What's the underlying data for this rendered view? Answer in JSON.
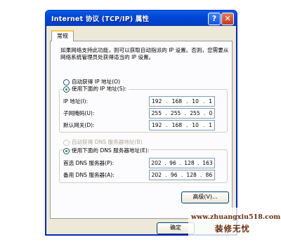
{
  "window": {
    "title": "Internet 协议 (TCP/IP) 属性",
    "help_glyph": "?",
    "close_glyph": "✕"
  },
  "tabs": [
    {
      "label": "常规",
      "selected": true
    }
  ],
  "description": "如果网络支持此功能，则可以获取自动指派的 IP 设置。否则，您需要从网络系统管理员处获得适当的 IP 设置。",
  "ip": {
    "auto_label": "自动获得 IP 地址(O)",
    "manual_label": "使用下面的 IP 地址(S):",
    "selected": "manual",
    "fields": [
      {
        "label": "IP 地址(I):",
        "octets": [
          "192",
          "168",
          "10",
          "1"
        ]
      },
      {
        "label": "子网掩码(U):",
        "octets": [
          "255",
          "255",
          "255",
          "0"
        ]
      },
      {
        "label": "默认网关(D):",
        "octets": [
          "192",
          "168",
          "10",
          "1"
        ]
      }
    ]
  },
  "dns": {
    "auto_label": "自动获得 DNS 服务器地址(B)",
    "manual_label": "使用下面的 DNS 服务器地址(E):",
    "selected": "manual",
    "fields": [
      {
        "label": "首选 DNS 服务器(P):",
        "octets": [
          "202",
          "96",
          "128",
          "163"
        ]
      },
      {
        "label": "备用 DNS 服务器(A):",
        "octets": [
          "202",
          "96",
          "128",
          "86"
        ]
      }
    ]
  },
  "buttons": {
    "advanced": "高级(V)...",
    "ok": "确定"
  },
  "watermark": {
    "url": "www.zhuangxiu518.com",
    "brand": "装修无忧"
  },
  "colors": {
    "title_bar": "#0146d6",
    "accent_tab": "#ffc83c",
    "dialog_bg": "#ece9d8"
  }
}
